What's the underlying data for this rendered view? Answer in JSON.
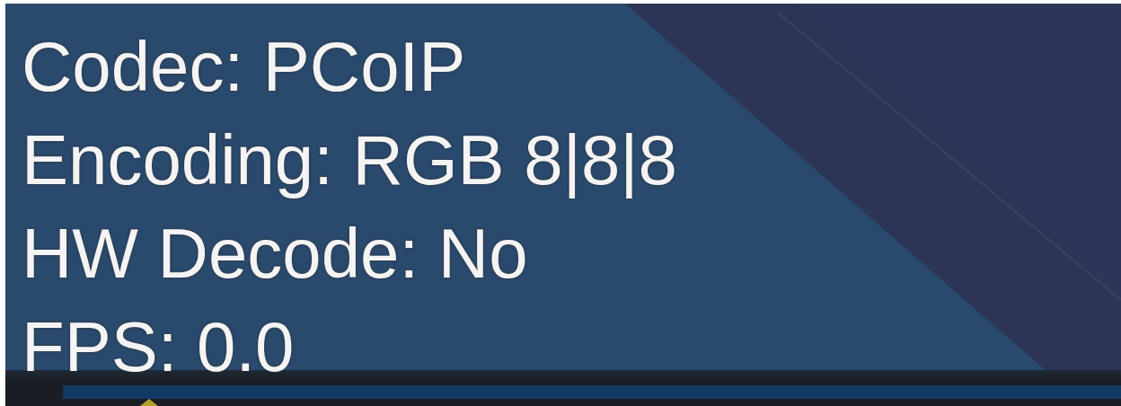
{
  "overlay": {
    "lines": [
      {
        "text": "Codec: PCoIP"
      },
      {
        "text": "Encoding: RGB 8|8|8"
      },
      {
        "text": "HW Decode: No"
      },
      {
        "text": "FPS: 0.0"
      }
    ]
  }
}
